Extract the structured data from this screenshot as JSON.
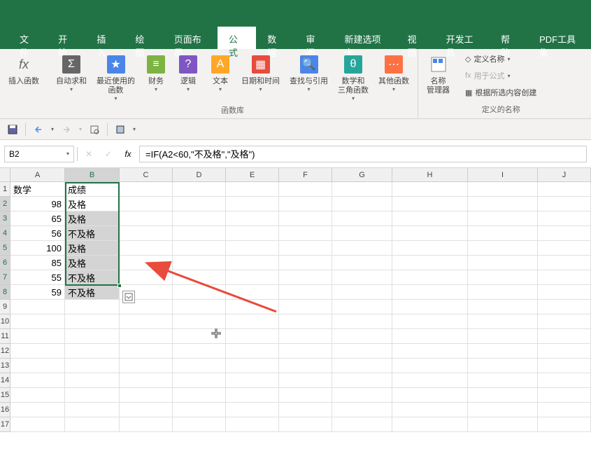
{
  "ribbon": {
    "tabs": [
      "文件",
      "开始",
      "插入",
      "绘图",
      "页面布局",
      "公式",
      "数据",
      "审阅",
      "新建选项卡",
      "视图",
      "开发工具",
      "帮助",
      "PDF工具集"
    ],
    "active_tab": "公式",
    "groups": {
      "insert_fn": {
        "label": "插入函数",
        "title": "fx"
      },
      "library": {
        "label": "函数库",
        "items": [
          {
            "label": "自动求和",
            "dd": true
          },
          {
            "label": "最近使用的\n函数",
            "dd": true
          },
          {
            "label": "财务",
            "dd": true
          },
          {
            "label": "逻辑",
            "dd": true
          },
          {
            "label": "文本",
            "dd": true
          },
          {
            "label": "日期和时间",
            "dd": true
          },
          {
            "label": "查找与引用",
            "dd": true
          },
          {
            "label": "数学和\n三角函数",
            "dd": true
          },
          {
            "label": "其他函数",
            "dd": true
          }
        ]
      },
      "name_mgr": {
        "label": "名称\n管理器"
      },
      "side": [
        {
          "label": "定义名称",
          "dd": true
        },
        {
          "label": "用于公式",
          "dd": true,
          "disabled": true
        },
        {
          "label": "根据所选内容创建"
        }
      ],
      "side_label": "定义的名称"
    }
  },
  "name_box": "B2",
  "formula": "=IF(A2<60,\"不及格\",\"及格\")",
  "columns": [
    "A",
    "B",
    "C",
    "D",
    "E",
    "F",
    "G",
    "H",
    "I",
    "J"
  ],
  "rows_count": 17,
  "data": {
    "A1": "数学",
    "B1": "成绩",
    "A2": "98",
    "B2": "及格",
    "A3": "65",
    "B3": "及格",
    "A4": "56",
    "B4": "不及格",
    "A5": "100",
    "B5": "及格",
    "A6": "85",
    "B6": "及格",
    "A7": "55",
    "B7": "不及格",
    "A8": "59",
    "B8": "不及格"
  },
  "selection": {
    "col": "B",
    "rows": [
      2,
      8
    ]
  },
  "active_cell": "B2"
}
